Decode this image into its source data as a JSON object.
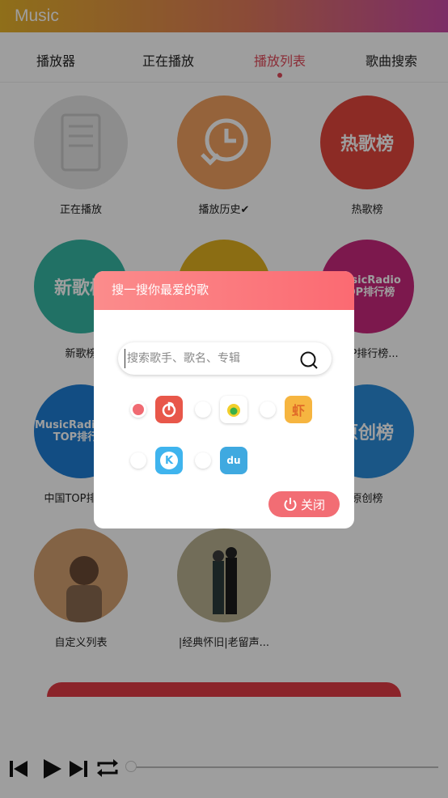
{
  "app": {
    "title": "Music"
  },
  "tabs": [
    {
      "label": "播放器"
    },
    {
      "label": "正在播放"
    },
    {
      "label": "播放列表",
      "active": true
    },
    {
      "label": "歌曲搜索"
    }
  ],
  "playlists": [
    {
      "label": "正在播放"
    },
    {
      "label": "播放历史✔"
    },
    {
      "label": "热歌榜",
      "cover_text": "热歌榜"
    },
    {
      "label": "新歌榜",
      "cover_text": "新歌榜"
    },
    {
      "label": "",
      "cover_text": ""
    },
    {
      "label": "TOP排行榜...",
      "cover_text": "MusicRadio TOP排行榜"
    },
    {
      "label": "中国TOP排行榜",
      "cover_text": "MusicRadio 中国TOP排行榜"
    },
    {
      "label": "原创榜",
      "cover_text": "原创榜"
    },
    {
      "label": "自定义列表"
    },
    {
      "label": "|经典怀旧|老留声..."
    }
  ],
  "player": {
    "prev_icon": "skip-previous-icon",
    "play_icon": "play-icon",
    "next_icon": "skip-next-icon",
    "repeat_icon": "repeat-icon",
    "progress": 0
  },
  "dialog": {
    "title": "搜一搜你最爱的歌",
    "search_placeholder": "搜索歌手、歌名、专辑",
    "search_value": "",
    "sources": [
      {
        "name": "netease",
        "icon": "netease-music-icon",
        "checked": true
      },
      {
        "name": "qq",
        "icon": "qq-music-icon",
        "checked": false
      },
      {
        "name": "xiami",
        "icon": "xiami-music-icon",
        "glyph": "虾",
        "checked": false
      },
      {
        "name": "kugou",
        "icon": "kugou-music-icon",
        "glyph": "K",
        "checked": false
      },
      {
        "name": "baidu",
        "icon": "baidu-music-icon",
        "glyph": "du",
        "checked": false
      }
    ],
    "close_label": "关闭"
  },
  "colors": {
    "accent": "#f26d74",
    "active_tab": "#e04a5a"
  }
}
